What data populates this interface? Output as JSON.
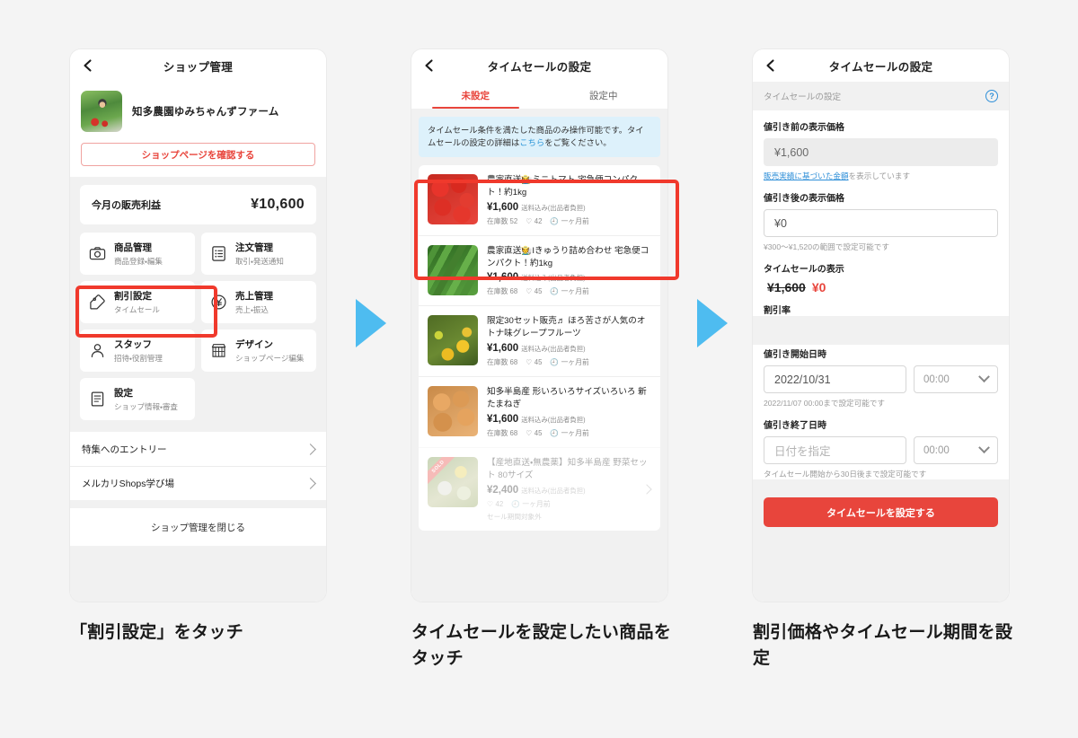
{
  "page": {
    "background": "#f4f4f4",
    "accent_red": "#e8453c",
    "arrow_blue": "#4ebcf0",
    "highlight_red": "#f0392c"
  },
  "phone1": {
    "navbar": {
      "title": "ショップ管理",
      "back_icon": "chevron-left-icon"
    },
    "shop": {
      "name": "知多農園ゆみちゃんずファーム",
      "view_page_button": "ショップページを確認する"
    },
    "profit": {
      "label": "今月の販売利益",
      "value": "¥10,600"
    },
    "menu": [
      {
        "icon": "camera-icon",
        "title": "商品管理",
        "subtitle": "商品登録・編集"
      },
      {
        "icon": "list-icon",
        "title": "注文管理",
        "subtitle": "取引・発送通知"
      },
      {
        "icon": "tag-icon",
        "title": "割引設定",
        "subtitle": "タイムセール"
      },
      {
        "icon": "yen-circle-icon",
        "title": "売上管理",
        "subtitle": "売上・振込"
      },
      {
        "icon": "person-icon",
        "title": "スタッフ",
        "subtitle": "招待・役割管理"
      },
      {
        "icon": "storefront-icon",
        "title": "デザイン",
        "subtitle": "ショップページ編集"
      },
      {
        "icon": "document-icon",
        "title": "設定",
        "subtitle": "ショップ情報・審査"
      }
    ],
    "links": [
      {
        "label": "特集へのエントリー"
      },
      {
        "label": "メルカリShops学び場"
      }
    ],
    "close_label": "ショップ管理を閉じる"
  },
  "phone2": {
    "navbar": {
      "title": "タイムセールの設定",
      "back_icon": "chevron-left-icon"
    },
    "tabs": [
      {
        "label": "未設定",
        "active": true
      },
      {
        "label": "設定中",
        "active": false
      }
    ],
    "notice": {
      "text_before": "タイムセール条件を満たした商品のみ操作可能です。タイムセールの設定の詳細は",
      "link": "こちら",
      "text_after": "をご覧ください。"
    },
    "products": [
      {
        "thumb": "tomato-thumbnail",
        "title": "農家直送🧑‍🌾ミニトマト 宅急便コンパクト！約1kg",
        "price": "¥1,600",
        "shipping": "送料込み(出品者負担)",
        "stock": "在庫数 52",
        "likes": "42",
        "time": "一ヶ月前",
        "dimmed": false
      },
      {
        "thumb": "cucumber-thumbnail",
        "title": "農家直送🧑‍🌾Iきゅうり詰め合わせ 宅急便コンパクト！約1kg",
        "price": "¥1,600",
        "shipping": "送料込み(出品者負担)",
        "stock": "在庫数 68",
        "likes": "45",
        "time": "一ヶ月前",
        "dimmed": false
      },
      {
        "thumb": "grapefruit-thumbnail",
        "title": "限定30セット販売♬ ほろ苦さが人気のオトナ味グレープフルーツ",
        "price": "¥1,600",
        "shipping": "送料込み(出品者負担)",
        "stock": "在庫数 68",
        "likes": "45",
        "time": "一ヶ月前",
        "dimmed": false
      },
      {
        "thumb": "onion-thumbnail",
        "title": "知多半島産 形いろいろサイズいろいろ 新たまねぎ",
        "price": "¥1,600",
        "shipping": "送料込み(出品者負担)",
        "stock": "在庫数 68",
        "likes": "45",
        "time": "一ヶ月前",
        "dimmed": false
      },
      {
        "thumb": "vegetable-set-thumbnail",
        "badge": "SOLD",
        "title": "【産地直送・無農薬】知多半島産 野菜セット 80サイズ",
        "price": "¥2,400",
        "shipping": "送料込み(出品者負担)",
        "stock": "",
        "likes": "42",
        "time": "一ヶ月前",
        "note": "セール期間対象外",
        "dimmed": true
      }
    ]
  },
  "phone3": {
    "navbar": {
      "title": "タイムセールの設定",
      "back_icon": "chevron-left-icon"
    },
    "section_header": {
      "label": "タイムセールの設定",
      "help_icon": "question-mark-icon"
    },
    "before_price": {
      "label": "値引き前の表示価格",
      "value": "¥1,600",
      "help_link": "販売実績に基づいた金額",
      "help_rest": "を表示しています"
    },
    "after_price": {
      "label": "値引き後の表示価格",
      "value": "¥0",
      "help": "¥300〜¥1,520の範囲で設定可能です"
    },
    "sale_display": {
      "label": "タイムセールの表示",
      "original": "¥1,600",
      "discounted": "¥0"
    },
    "discount_rate_label": "割引率",
    "start": {
      "label": "値引き開始日時",
      "date": "2022/10/31",
      "time": "00:00",
      "help": "2022/11/07 00:00まで設定可能です",
      "chevron_icon": "chevron-down-icon"
    },
    "end": {
      "label": "値引き終了日時",
      "date_placeholder": "日付を指定",
      "time": "00:00",
      "help": "タイムセール開始から30日後まで設定可能です",
      "chevron_icon": "chevron-down-icon"
    },
    "cta": "タイムセールを設定する"
  },
  "captions": {
    "one": "「割引設定」をタッチ",
    "two": "タイムセールを設定したい商品をタッチ",
    "three": "割引価格やタイムセール期間を設定"
  }
}
